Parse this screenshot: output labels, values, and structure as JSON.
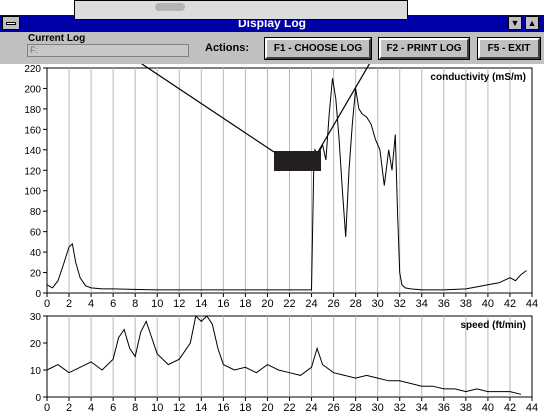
{
  "window": {
    "title": "Display Log"
  },
  "toolbar": {
    "current_log_label": "Current Log",
    "current_log_value": "F:",
    "actions_label": "Actions:",
    "choose_label": "F1 - CHOOSE LOG",
    "print_label": "F2 - PRINT LOG",
    "exit_label": "F5 - EXIT"
  },
  "chart_data": [
    {
      "type": "line",
      "title": "conductivity (mS/m)",
      "xlabel": "",
      "ylabel": "",
      "xlim": [
        0,
        44
      ],
      "ylim": [
        0,
        220
      ],
      "x_ticks": [
        0,
        2,
        4,
        6,
        8,
        10,
        12,
        14,
        16,
        18,
        20,
        22,
        24,
        26,
        28,
        30,
        32,
        34,
        36,
        38,
        40,
        42,
        44
      ],
      "y_ticks": [
        0,
        20,
        40,
        60,
        80,
        100,
        120,
        140,
        160,
        180,
        200,
        220
      ],
      "grid": "vertical",
      "series": [
        {
          "x": [
            0,
            0.5,
            1,
            1.5,
            2,
            2.3,
            2.6,
            3,
            3.5,
            4,
            5,
            6,
            10,
            14,
            18,
            22,
            24,
            24.2,
            24.3,
            24.6,
            25,
            25.3,
            25.6,
            25.9,
            26.2,
            26.5,
            26.8,
            27.1,
            27.4,
            27.7,
            28,
            28.3,
            28.6,
            29,
            29.4,
            29.8,
            30.2,
            30.6,
            31,
            31.3,
            31.6,
            31.8,
            32,
            32.2,
            32.5,
            33,
            34,
            36,
            38,
            39,
            40,
            41,
            42,
            42.5,
            43,
            43.5
          ],
          "y": [
            8,
            5,
            12,
            28,
            45,
            48,
            30,
            15,
            7,
            5,
            4,
            4,
            3,
            3,
            3,
            3,
            3,
            120,
            140,
            135,
            145,
            130,
            175,
            210,
            190,
            150,
            100,
            55,
            120,
            165,
            200,
            180,
            175,
            172,
            165,
            150,
            140,
            105,
            140,
            120,
            155,
            80,
            20,
            8,
            5,
            4,
            3,
            3,
            4,
            6,
            8,
            10,
            15,
            12,
            18,
            22
          ]
        }
      ]
    },
    {
      "type": "line",
      "title": "speed (ft/min)",
      "xlabel": "",
      "ylabel": "",
      "xlim": [
        0,
        44
      ],
      "ylim": [
        0,
        30
      ],
      "x_ticks": [
        0,
        2,
        4,
        6,
        8,
        10,
        12,
        14,
        16,
        18,
        20,
        22,
        24,
        26,
        28,
        30,
        32,
        34,
        36,
        38,
        40,
        42,
        44
      ],
      "y_ticks": [
        0,
        10,
        20,
        30
      ],
      "grid": "vertical",
      "series": [
        {
          "x": [
            0,
            1,
            2,
            3,
            4,
            5,
            6,
            6.5,
            7,
            7.5,
            8,
            8.5,
            9,
            9.5,
            10,
            11,
            12,
            13,
            13.5,
            14,
            14.5,
            15,
            15.5,
            16,
            17,
            18,
            19,
            20,
            21,
            22,
            23,
            24,
            24.5,
            25,
            26,
            27,
            28,
            29,
            30,
            31,
            32,
            33,
            34,
            35,
            36,
            37,
            38,
            39,
            40,
            41,
            42,
            43
          ],
          "y": [
            10,
            12,
            9,
            11,
            13,
            10,
            14,
            22,
            25,
            18,
            15,
            24,
            28,
            22,
            16,
            12,
            14,
            20,
            30,
            28,
            30,
            27,
            18,
            12,
            10,
            11,
            9,
            12,
            10,
            9,
            8,
            11,
            18,
            12,
            9,
            8,
            7,
            8,
            7,
            6,
            6,
            5,
            4,
            4,
            3,
            3,
            2,
            3,
            2,
            2,
            2,
            1
          ]
        }
      ]
    }
  ]
}
